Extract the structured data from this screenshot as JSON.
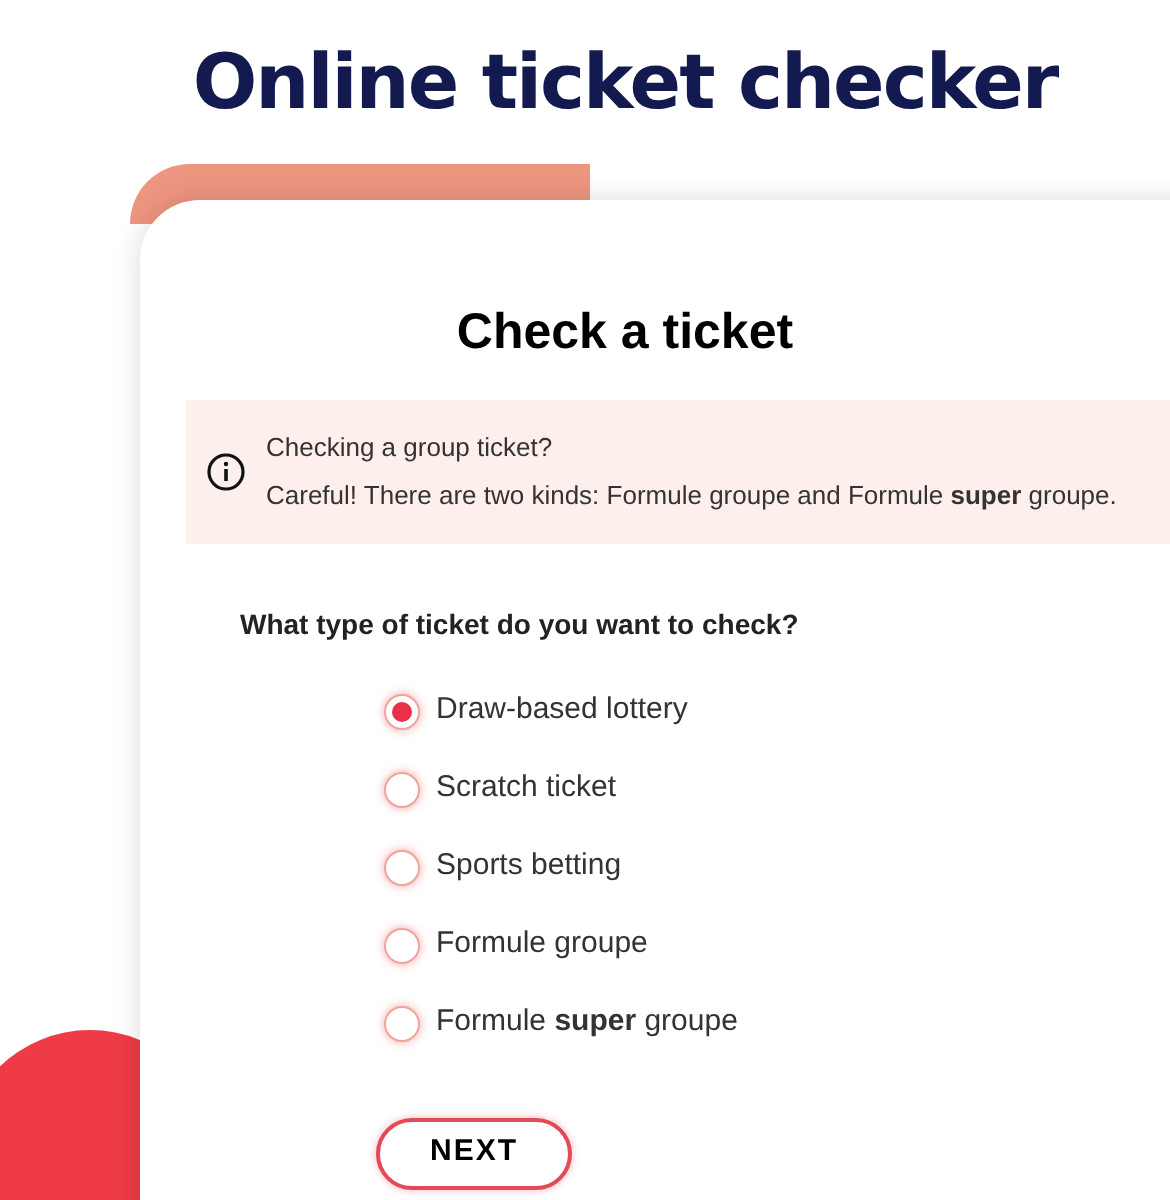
{
  "page_title": "Online ticket checker",
  "card": {
    "title": "Check a ticket",
    "notice": {
      "title": "Checking a group ticket?",
      "text": "Careful! There are two kinds: Formule groupe and Formule **super** groupe."
    },
    "question": "What type of ticket do you want to check?",
    "options": [
      {
        "label": "Draw-based lottery",
        "selected": true
      },
      {
        "label": "Scratch ticket",
        "selected": false
      },
      {
        "label": "Sports betting",
        "selected": false
      },
      {
        "label": "Formule groupe",
        "selected": false
      },
      {
        "label": "Formule **super** groupe",
        "selected": false
      }
    ],
    "button": "NEXT"
  }
}
